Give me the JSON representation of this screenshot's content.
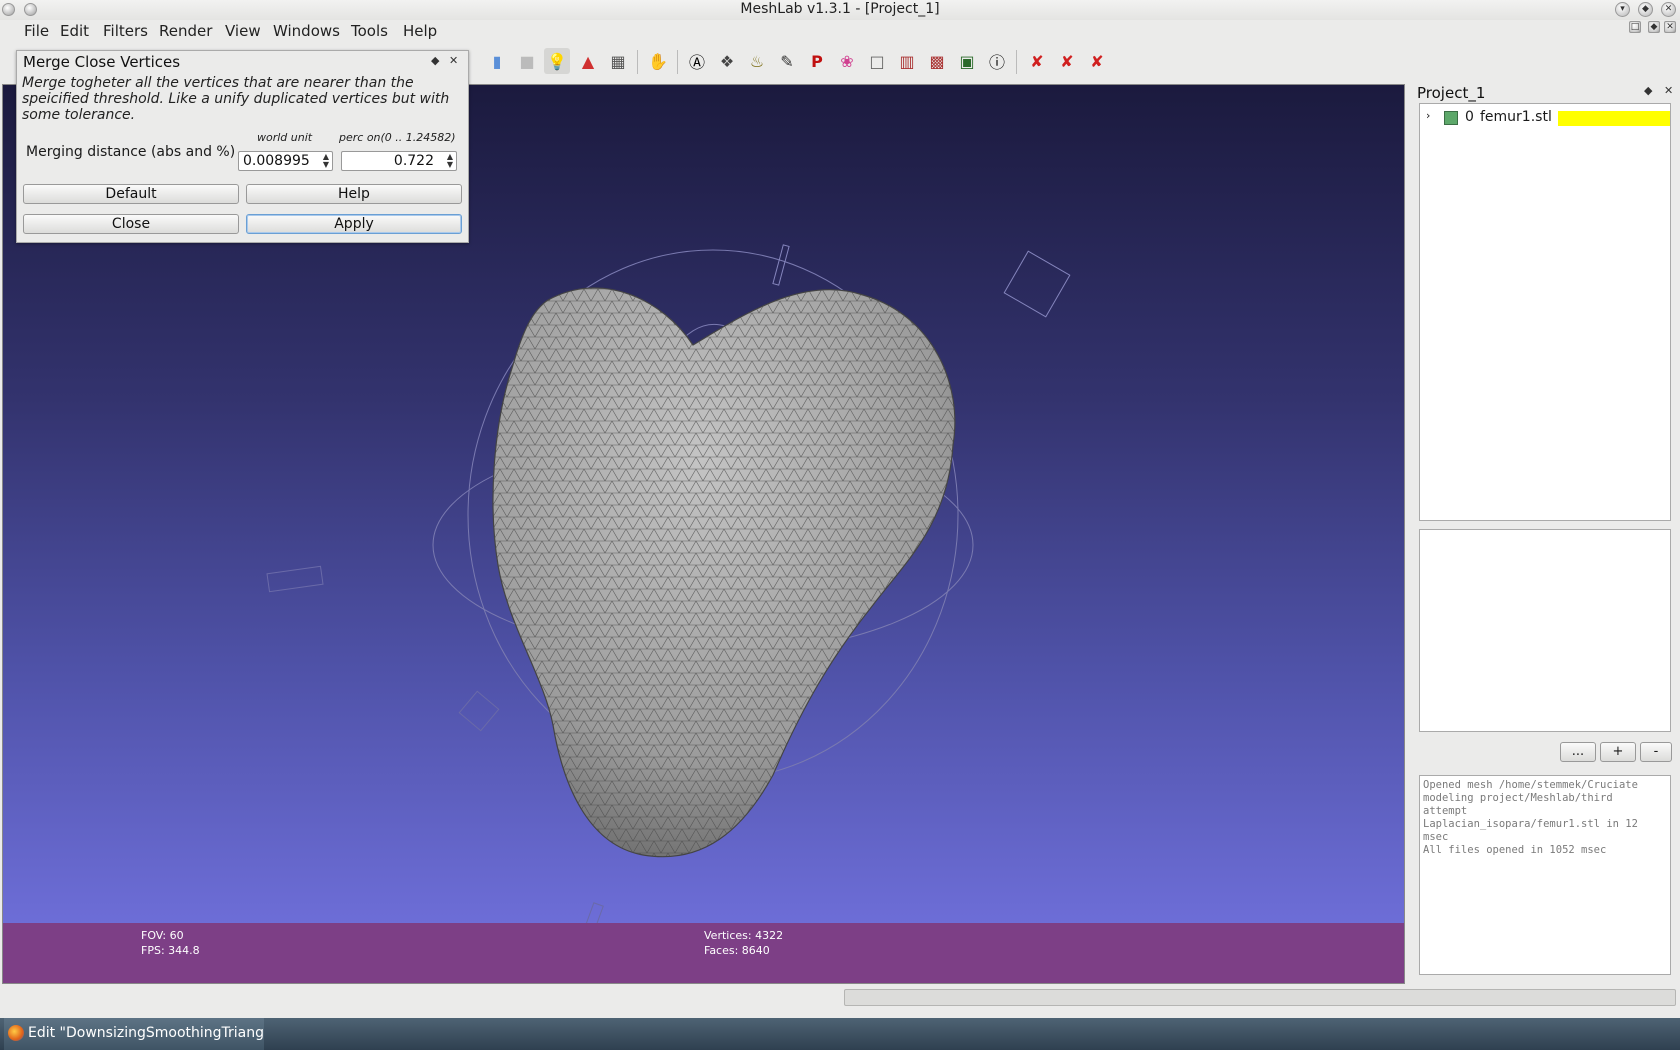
{
  "window": {
    "title": "MeshLab v1.3.1 - [Project_1]"
  },
  "menu": [
    "File",
    "Edit",
    "Filters",
    "Render",
    "View",
    "Windows",
    "Tools",
    "Help"
  ],
  "dialog": {
    "title": "Merge Close Vertices",
    "description": "Merge togheter all the vertices that are nearer than the speicified threshold. Like a unify duplicated vertices but with some tolerance.",
    "col_world": "world unit",
    "col_perc": "perc on(0 .. 1.24582)",
    "param_label": "Merging distance (abs and %)",
    "world_value": "0.008995",
    "perc_value": "0.722",
    "buttons": {
      "default": "Default",
      "help": "Help",
      "close": "Close",
      "apply": "Apply"
    }
  },
  "viewport": {
    "fov_label": "FOV: 60",
    "fps_label": "FPS:  344.8",
    "vertices_label": "Vertices: 4322",
    "faces_label": "Faces: 8640",
    "bg_top": "#1b1a3e",
    "bg_bottom": "#7474e2",
    "info_color": "#7d3f86"
  },
  "project": {
    "title": "Project_1",
    "layers": [
      {
        "index": "0",
        "name": "femur1.stl",
        "highlight": "#ffff00"
      }
    ],
    "buttons": {
      "more": "...",
      "add": "+",
      "remove": "-"
    },
    "log": [
      "Opened mesh /home/stemmek/Cruciate",
      "modeling project/Meshlab/third",
      "attempt",
      "Laplacian_isopara/femur1.stl in 12",
      "msec",
      "All files opened in 1052 msec"
    ]
  },
  "taskbar": {
    "active_item": "Edit \"DownsizingSmoothingTriangular"
  }
}
